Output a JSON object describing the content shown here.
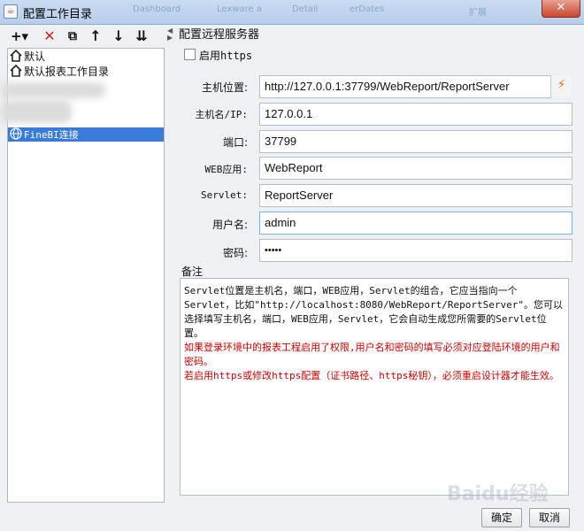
{
  "window": {
    "title": "配置工作目录",
    "ghost_tabs": [
      "Dashboard",
      "Lexware a",
      "Detail",
      "erDates",
      "扩展"
    ],
    "close_glyph": "✕"
  },
  "toolbar": {
    "add": "+▾",
    "delete": "✕",
    "copy": "⧉",
    "up": "↑",
    "down": "↓",
    "export": "⇊"
  },
  "tree": {
    "items": [
      {
        "label": "默认",
        "icon": "home-icon"
      },
      {
        "label": "默认报表工作目录",
        "icon": "home-icon"
      },
      {
        "label": "FineBI连接",
        "icon": "globe-icon",
        "selected": true
      }
    ]
  },
  "form": {
    "group_title": "配置远程服务器",
    "https_label": "启用https",
    "https_checked": false,
    "host_label": "主机位置:",
    "host_value": "http://127.0.0.1:37799/WebReport/ReportServer",
    "hostname_label": "主机名/IP:",
    "hostname_value": "127.0.0.1",
    "port_label": "端口:",
    "port_value": "37799",
    "webapp_label": "WEB应用:",
    "webapp_value": "WebReport",
    "servlet_label": "Servlet:",
    "servlet_value": "ReportServer",
    "user_label": "用户名:",
    "user_value": "admin",
    "password_label": "密码:",
    "password_value": "•••••"
  },
  "notes": {
    "title": "备注",
    "line1": "Servlet位置是主机名，端口，WEB应用，Servlet的组合，它应当指向一个Servlet，比如\"http://localhost:8080/WebReport/ReportServer\"。您可以选择填写主机名，端口，WEB应用，Servlet，它会自动生成您所需要的Servlet位置。",
    "red1": "如果登录环境中的报表工程启用了权限,用户名和密码的填写必须对应登陆环境的用户和密码。",
    "red2": "若启用https或修改https配置（证书路径、https秘钥），必须重启设计器才能生效。"
  },
  "buttons": {
    "ok": "确定",
    "cancel": "取消"
  },
  "watermark": "Baidu经验",
  "colors": {
    "selection": "#3a7ad8",
    "warning_text": "#d00000"
  }
}
